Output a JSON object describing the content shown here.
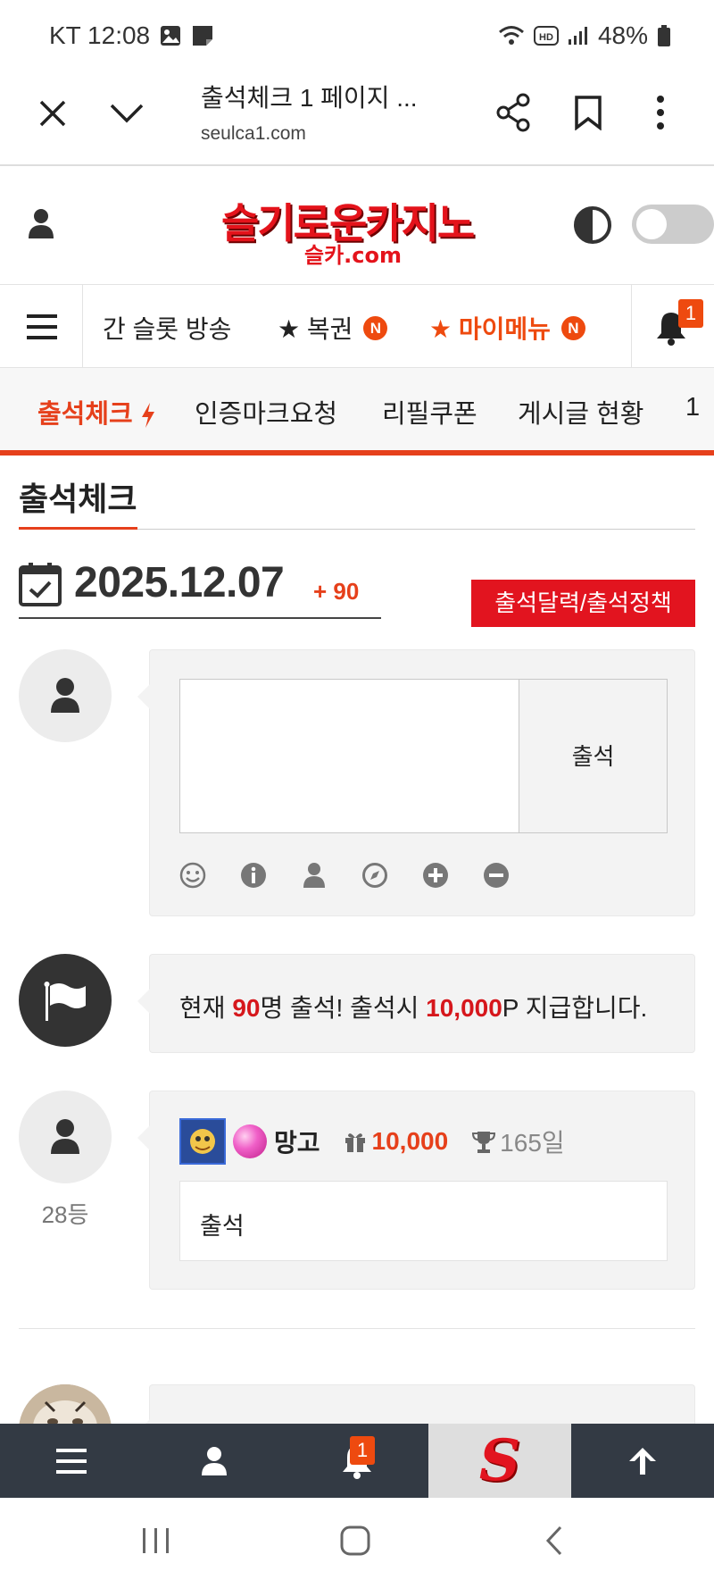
{
  "status_bar": {
    "carrier_time": "KT 12:08",
    "battery": "48%",
    "icons": [
      "image-icon",
      "note-icon",
      "wifi-icon",
      "hd-icon",
      "signal-icon",
      "battery-icon"
    ]
  },
  "browser": {
    "title": "출석체크 1 페이지 ...",
    "domain": "seulca1.com"
  },
  "header": {
    "logo_text": "슬기로운카지노",
    "logo_sub": "슬카.com"
  },
  "main_nav": {
    "items": [
      {
        "label": "간 슬롯 방송"
      },
      {
        "label": "★ 복권",
        "badge": "N"
      },
      {
        "label": "★ 마이메뉴",
        "badge": "N"
      }
    ],
    "bell_count": "1"
  },
  "sub_nav": {
    "items": [
      "출석체크",
      "인증마크요청",
      "리필쿠폰",
      "게시글 현황",
      "1"
    ]
  },
  "page": {
    "title": "출석체크",
    "date": "2025.12.07",
    "date_plus": "+ 90",
    "policy_button": "출석달력/출석정책"
  },
  "form": {
    "attend_button": "출석",
    "tools": [
      "smile-icon",
      "info-icon",
      "user-icon",
      "compass-icon",
      "plus-circle-icon",
      "minus-circle-icon"
    ]
  },
  "notice": {
    "prefix": "현재 ",
    "count": "90",
    "mid": "명 출석! 출석시 ",
    "points": "10,000",
    "suffix": "P 지급합니다."
  },
  "entry": {
    "nickname": "망고",
    "points": "10,000",
    "days": "165일",
    "comment": "출석",
    "rank": "28등"
  },
  "tab_bar": {
    "bell_count": "1",
    "logo_letter": "S"
  },
  "colors": {
    "accent_orange": "#e6401b",
    "brand_red": "#e2141f",
    "tab_bar": "#333a44"
  }
}
